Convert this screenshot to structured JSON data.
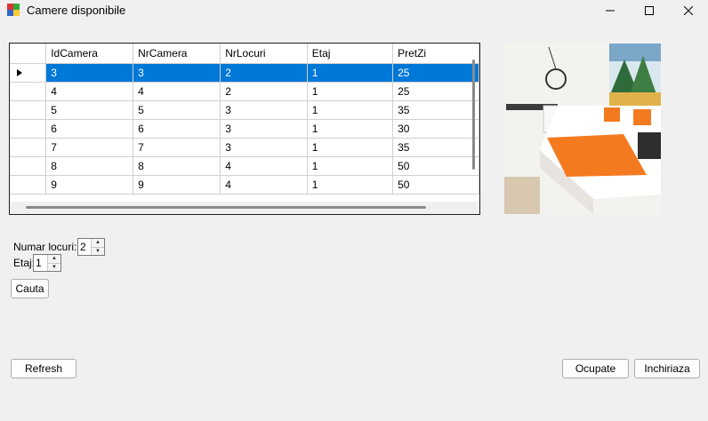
{
  "window": {
    "title": "Camere disponibile"
  },
  "grid": {
    "columns": [
      "IdCamera",
      "NrCamera",
      "NrLocuri",
      "Etaj",
      "PretZi"
    ],
    "rows": [
      [
        "3",
        "3",
        "2",
        "1",
        "25"
      ],
      [
        "4",
        "4",
        "2",
        "1",
        "25"
      ],
      [
        "5",
        "5",
        "3",
        "1",
        "35"
      ],
      [
        "6",
        "6",
        "3",
        "1",
        "30"
      ],
      [
        "7",
        "7",
        "3",
        "1",
        "35"
      ],
      [
        "8",
        "8",
        "4",
        "1",
        "50"
      ],
      [
        "9",
        "9",
        "4",
        "1",
        "50"
      ]
    ],
    "selected_row": 0
  },
  "filters": {
    "numar_locuri_label": "Numar locuri:",
    "numar_locuri_value": "2",
    "etaj_label": "Etaj:",
    "etaj_value": "1"
  },
  "buttons": {
    "cauta": "Cauta",
    "refresh": "Refresh",
    "ocupate": "Ocupate",
    "inchiriaza": "Inchiriaza"
  },
  "colors": {
    "selection": "#0078d7",
    "background": "#f0f0f0"
  }
}
